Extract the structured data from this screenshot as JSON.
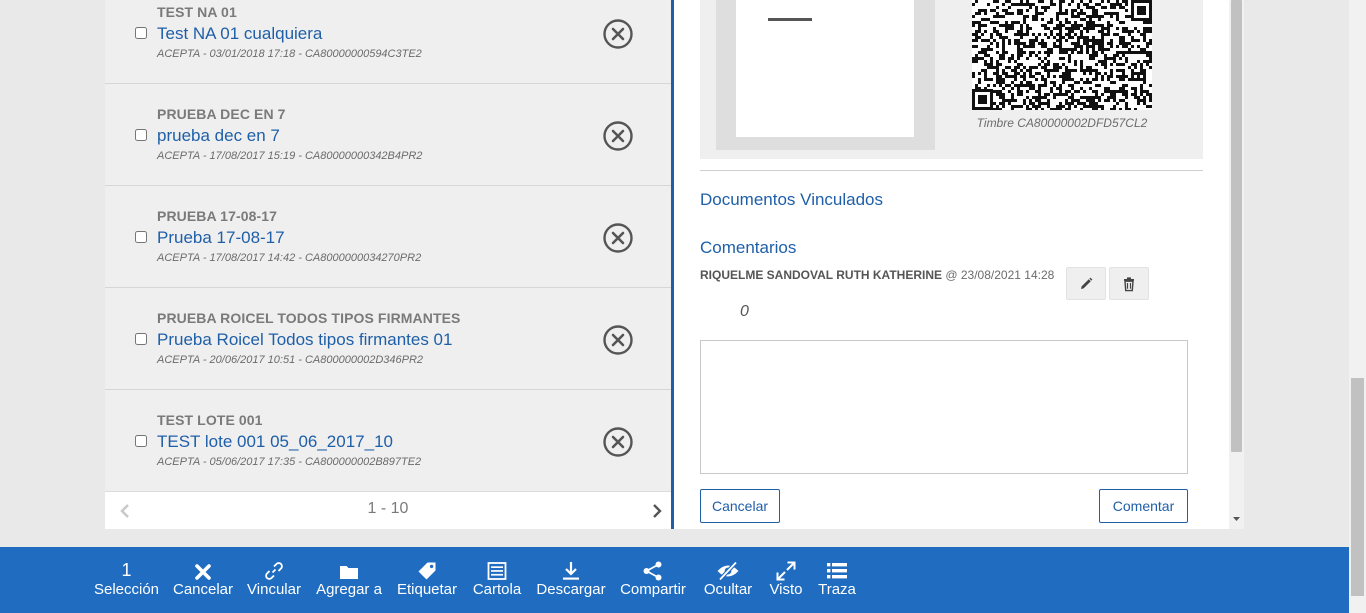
{
  "list": {
    "items": [
      {
        "category": "TEST NA 01",
        "title": "Test NA 01 cualquiera",
        "meta": "ACEPTA - 03/01/2018 17:18 - CA80000000594C3TE2"
      },
      {
        "category": "PRUEBA DEC EN 7",
        "title": "prueba dec en 7",
        "meta": "ACEPTA - 17/08/2017 15:19 - CA80000000342B4PR2"
      },
      {
        "category": "PRUEBA 17-08-17",
        "title": "Prueba 17-08-17",
        "meta": "ACEPTA - 17/08/2017 14:42 - CA8000000034270PR2"
      },
      {
        "category": "PRUEBA ROICEL TODOS TIPOS FIRMANTES",
        "title": "Prueba Roicel Todos tipos firmantes 01",
        "meta": "ACEPTA - 20/06/2017 10:51 - CA800000002D346PR2"
      },
      {
        "category": "TEST LOTE 001",
        "title": "TEST lote 001 05_06_2017_10",
        "meta": "ACEPTA - 05/06/2017 17:35 - CA800000002B897TE2"
      }
    ],
    "pager": "1 - 10"
  },
  "detail": {
    "timbre": "Timbre CA80000002DFD57CL2",
    "linked_title": "Documentos Vinculados",
    "comments_title": "Comentarios",
    "comment": {
      "author": "RIQUELME SANDOVAL RUTH KATHERINE",
      "date": "@ 23/08/2021 14:28",
      "body": "0"
    },
    "cancel_label": "Cancelar",
    "submit_label": "Comentar"
  },
  "toolbar": {
    "selection_count": "1",
    "items": [
      {
        "label": "Selección",
        "icon": "selection-count"
      },
      {
        "label": "Cancelar",
        "icon": "x-icon"
      },
      {
        "label": "Vincular",
        "icon": "link-icon"
      },
      {
        "label": "Agregar a",
        "icon": "folder-icon"
      },
      {
        "label": "Etiquetar",
        "icon": "tag-icon"
      },
      {
        "label": "Cartola",
        "icon": "list-alt-icon"
      },
      {
        "label": "Descargar",
        "icon": "download-icon"
      },
      {
        "label": "Compartir",
        "icon": "share-icon"
      },
      {
        "label": "Ocultar",
        "icon": "eye-slash-icon"
      },
      {
        "label": "Visto",
        "icon": "expand-icon"
      },
      {
        "label": "Traza",
        "icon": "list-icon"
      }
    ]
  },
  "colors": {
    "accent": "#1f5fa8",
    "toolbar": "#1f6cc1"
  }
}
